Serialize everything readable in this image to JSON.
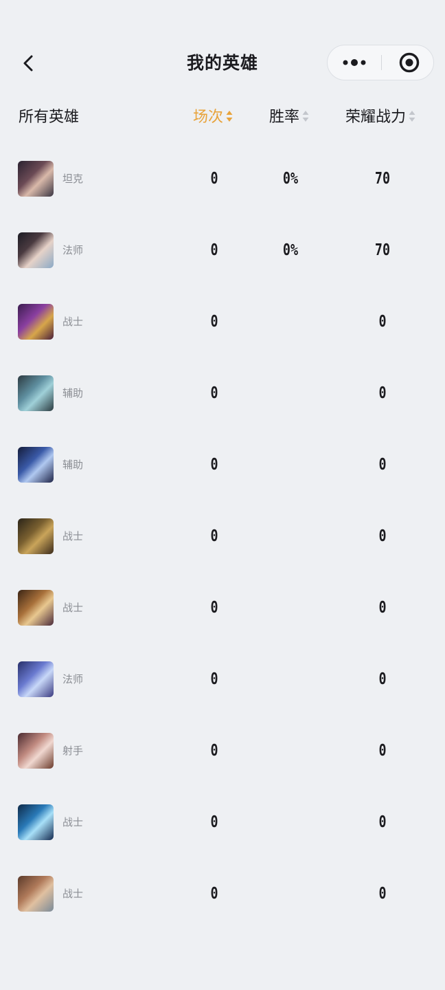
{
  "nav": {
    "title": "我的英雄",
    "back_icon": "chevron-left-icon",
    "more_icon": "more-dots-icon",
    "close_icon": "target-circle-icon"
  },
  "table": {
    "headers": {
      "all": "所有英雄",
      "games": "场次",
      "winrate": "胜率",
      "power": "荣耀战力"
    },
    "active_sort_color": "#e8a33b",
    "rows": [
      {
        "role": "坦克",
        "games": "0",
        "winrate": "0%",
        "power": "70"
      },
      {
        "role": "法师",
        "games": "0",
        "winrate": "0%",
        "power": "70"
      },
      {
        "role": "战士",
        "games": "0",
        "winrate": "",
        "power": "0"
      },
      {
        "role": "辅助",
        "games": "0",
        "winrate": "",
        "power": "0"
      },
      {
        "role": "辅助",
        "games": "0",
        "winrate": "",
        "power": "0"
      },
      {
        "role": "战士",
        "games": "0",
        "winrate": "",
        "power": "0"
      },
      {
        "role": "战士",
        "games": "0",
        "winrate": "",
        "power": "0"
      },
      {
        "role": "法师",
        "games": "0",
        "winrate": "",
        "power": "0"
      },
      {
        "role": "射手",
        "games": "0",
        "winrate": "",
        "power": "0"
      },
      {
        "role": "战士",
        "games": "0",
        "winrate": "",
        "power": "0"
      },
      {
        "role": "战士",
        "games": "0",
        "winrate": "",
        "power": "0"
      }
    ]
  }
}
